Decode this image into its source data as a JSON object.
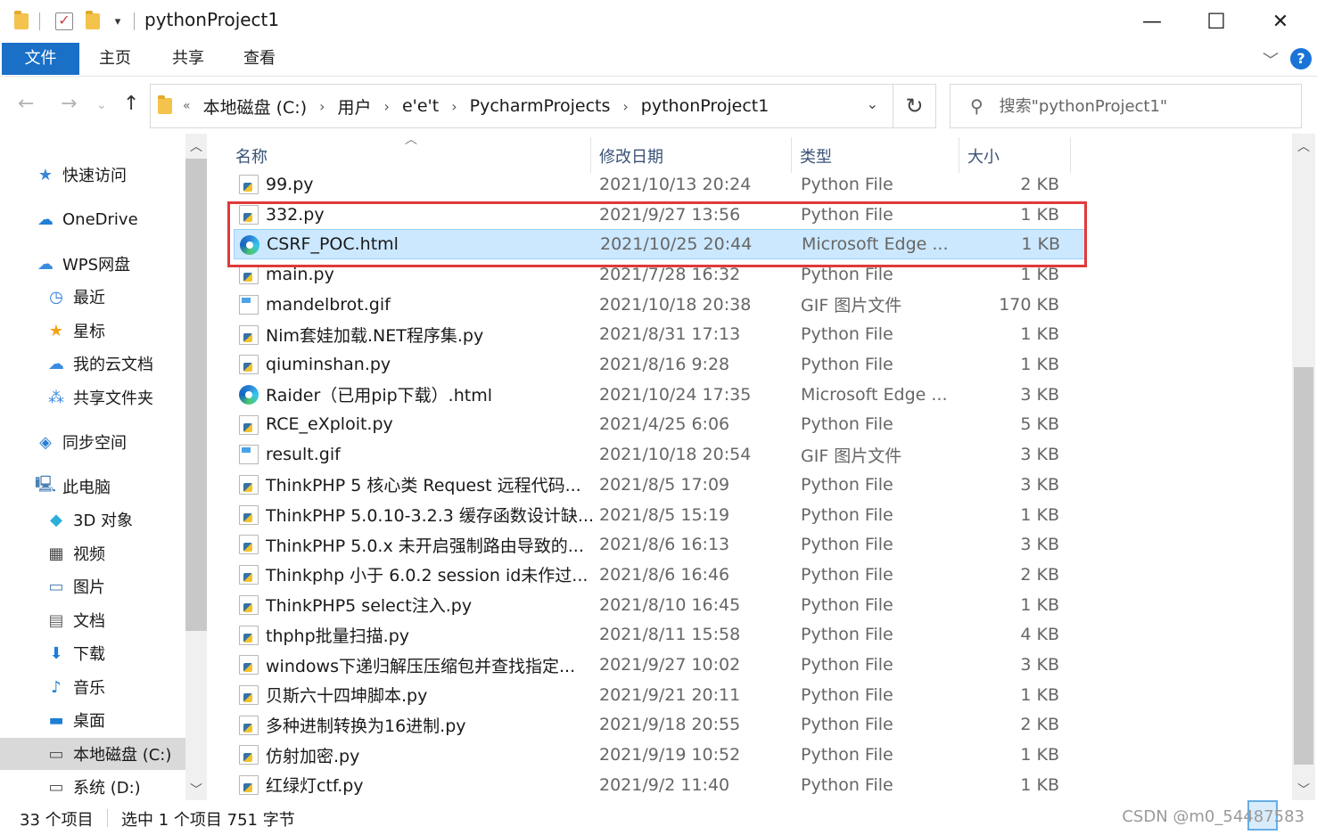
{
  "window": {
    "title": "pythonProject1",
    "minimize": "—",
    "maximize": "☐",
    "close": "✕"
  },
  "ribbon": {
    "tabs": [
      "文件",
      "主页",
      "共享",
      "查看"
    ]
  },
  "address": {
    "prefix": "«",
    "segments": [
      "本地磁盘 (C:)",
      "用户",
      "e'e't",
      "PycharmProjects",
      "pythonProject1"
    ]
  },
  "search": {
    "placeholder": "搜索\"pythonProject1\""
  },
  "sidebar": {
    "items": [
      {
        "label": "快速访问",
        "icon": "star-icon"
      },
      {
        "label": "OneDrive",
        "icon": "cloud-icon"
      },
      {
        "label": "WPS网盘",
        "icon": "wps-cloud-icon"
      },
      {
        "label": "最近",
        "icon": "clock-icon"
      },
      {
        "label": "星标",
        "icon": "star-icon"
      },
      {
        "label": "我的云文档",
        "icon": "cloud-doc-icon"
      },
      {
        "label": "共享文件夹",
        "icon": "share-icon"
      },
      {
        "label": "同步空间",
        "icon": "sync-icon"
      },
      {
        "label": "此电脑",
        "icon": "computer-icon"
      },
      {
        "label": "3D 对象",
        "icon": "cube-icon"
      },
      {
        "label": "视频",
        "icon": "video-icon"
      },
      {
        "label": "图片",
        "icon": "image-icon"
      },
      {
        "label": "文档",
        "icon": "document-icon"
      },
      {
        "label": "下载",
        "icon": "download-icon"
      },
      {
        "label": "音乐",
        "icon": "music-icon"
      },
      {
        "label": "桌面",
        "icon": "desktop-icon"
      },
      {
        "label": "本地磁盘 (C:)",
        "icon": "drive-icon"
      },
      {
        "label": "系统 (D:)",
        "icon": "drive-icon"
      }
    ]
  },
  "columns": {
    "name": "名称",
    "date": "修改日期",
    "type": "类型",
    "size": "大小"
  },
  "files": [
    {
      "name": "99.py",
      "date": "2021/10/13 20:24",
      "type": "Python File",
      "size": "2 KB",
      "icon": "py"
    },
    {
      "name": "332.py",
      "date": "2021/9/27 13:56",
      "type": "Python File",
      "size": "1 KB",
      "icon": "py"
    },
    {
      "name": "CSRF_POC.html",
      "date": "2021/10/25 20:44",
      "type": "Microsoft Edge ...",
      "size": "1 KB",
      "icon": "edge"
    },
    {
      "name": "main.py",
      "date": "2021/7/28 16:32",
      "type": "Python File",
      "size": "1 KB",
      "icon": "py"
    },
    {
      "name": "mandelbrot.gif",
      "date": "2021/10/18 20:38",
      "type": "GIF 图片文件",
      "size": "170 KB",
      "icon": "gif"
    },
    {
      "name": "Nim套娃加载.NET程序集.py",
      "date": "2021/8/31 17:13",
      "type": "Python File",
      "size": "1 KB",
      "icon": "py"
    },
    {
      "name": "qiuminshan.py",
      "date": "2021/8/16 9:28",
      "type": "Python File",
      "size": "1 KB",
      "icon": "py"
    },
    {
      "name": "Raider（已用pip下载）.html",
      "date": "2021/10/24 17:35",
      "type": "Microsoft Edge ...",
      "size": "3 KB",
      "icon": "edge"
    },
    {
      "name": "RCE_eXploit.py",
      "date": "2021/4/25 6:06",
      "type": "Python File",
      "size": "5 KB",
      "icon": "py"
    },
    {
      "name": "result.gif",
      "date": "2021/10/18 20:54",
      "type": "GIF 图片文件",
      "size": "3 KB",
      "icon": "gif"
    },
    {
      "name": "ThinkPHP 5 核心类 Request 远程代码...",
      "date": "2021/8/5 17:09",
      "type": "Python File",
      "size": "3 KB",
      "icon": "py"
    },
    {
      "name": "ThinkPHP 5.0.10-3.2.3 缓存函数设计缺...",
      "date": "2021/8/5 15:19",
      "type": "Python File",
      "size": "1 KB",
      "icon": "py"
    },
    {
      "name": "ThinkPHP 5.0.x 未开启强制路由导致的...",
      "date": "2021/8/6 16:13",
      "type": "Python File",
      "size": "3 KB",
      "icon": "py"
    },
    {
      "name": "Thinkphp 小于 6.0.2 session id未作过...",
      "date": "2021/8/6 16:46",
      "type": "Python File",
      "size": "2 KB",
      "icon": "py"
    },
    {
      "name": "ThinkPHP5 select注入.py",
      "date": "2021/8/10 16:45",
      "type": "Python File",
      "size": "1 KB",
      "icon": "py"
    },
    {
      "name": "thphp批量扫描.py",
      "date": "2021/8/11 15:58",
      "type": "Python File",
      "size": "4 KB",
      "icon": "py"
    },
    {
      "name": "windows下递归解压压缩包并查找指定...",
      "date": "2021/9/27 10:02",
      "type": "Python File",
      "size": "3 KB",
      "icon": "py"
    },
    {
      "name": "贝斯六十四坤脚本.py",
      "date": "2021/9/21 20:11",
      "type": "Python File",
      "size": "1 KB",
      "icon": "py"
    },
    {
      "name": "多种进制转换为16进制.py",
      "date": "2021/9/18 20:55",
      "type": "Python File",
      "size": "2 KB",
      "icon": "py"
    },
    {
      "name": "仿射加密.py",
      "date": "2021/9/19 10:52",
      "type": "Python File",
      "size": "1 KB",
      "icon": "py"
    },
    {
      "name": "红绿灯ctf.py",
      "date": "2021/9/2 11:40",
      "type": "Python File",
      "size": "1 KB",
      "icon": "py"
    }
  ],
  "status": {
    "count": "33 个项目",
    "selection": "选中 1 个项目  751 字节",
    "watermark": "CSDN @m0_54487583"
  }
}
